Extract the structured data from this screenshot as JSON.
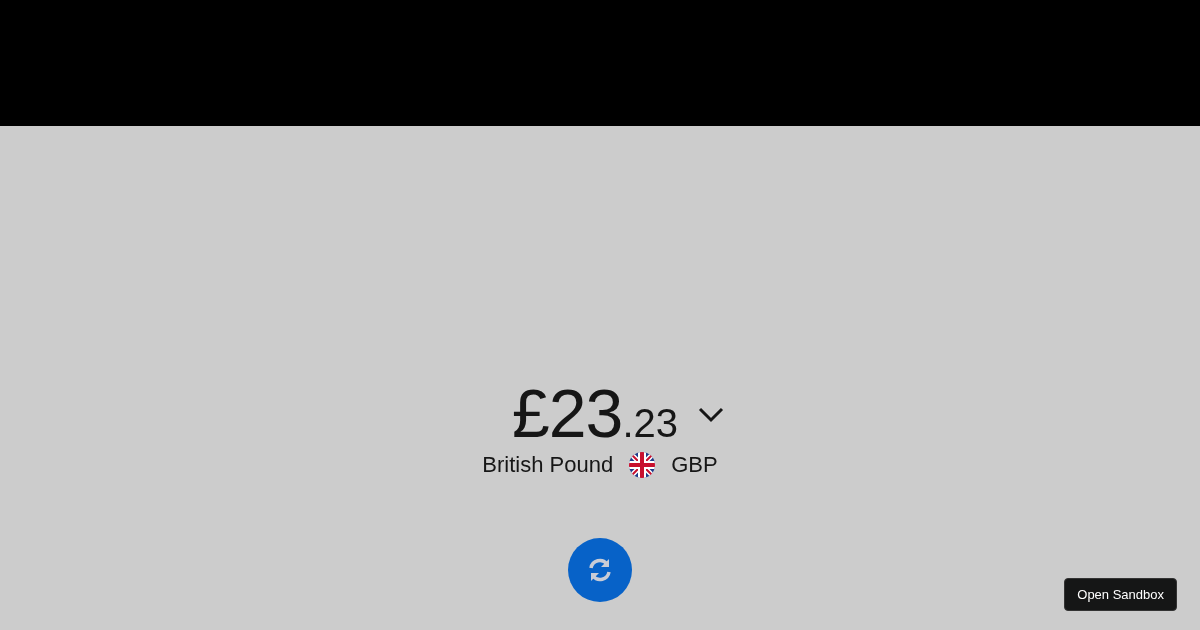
{
  "amount": {
    "whole": "£23",
    "fraction": ".23"
  },
  "currency": {
    "name": "British Pound",
    "code": "GBP"
  },
  "sandbox_button": "Open Sandbox"
}
